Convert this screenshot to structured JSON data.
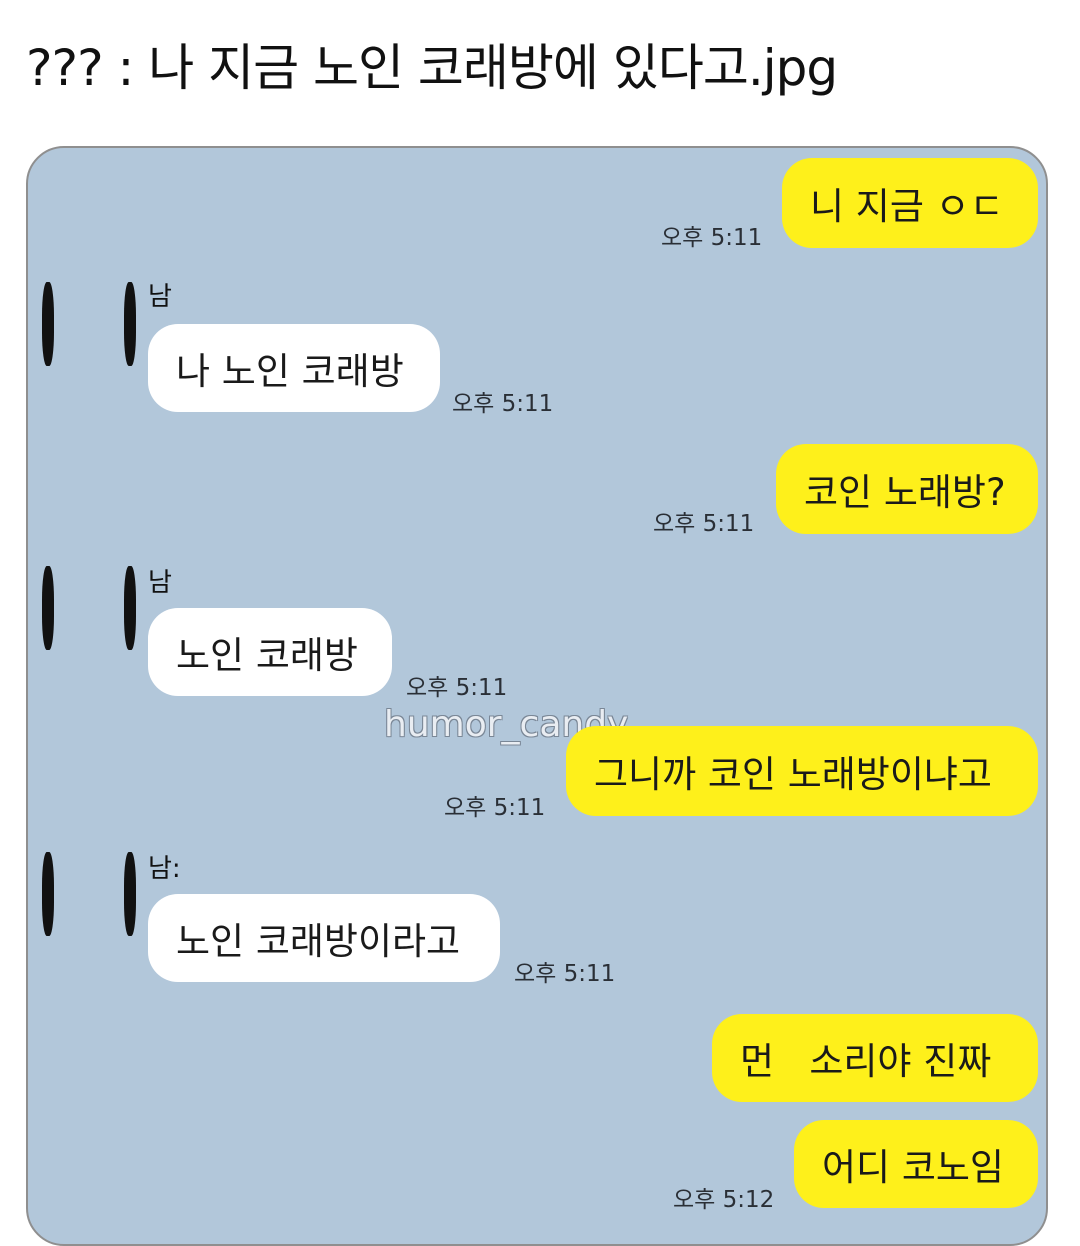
{
  "post": {
    "title": "??? : 나 지금 노인 코래방에 있다고.jpg"
  },
  "watermark": "humor_candy_",
  "messages": [
    {
      "side": "me",
      "text": "니 지금 ㅇㄷ",
      "time": "오후 5:11"
    },
    {
      "side": "them",
      "sender": "남",
      "text": "나 노인 코래방",
      "time": "오후 5:11"
    },
    {
      "side": "me",
      "text": "코인 노래방?",
      "time": "오후 5:11"
    },
    {
      "side": "them",
      "sender": "남",
      "text": "노인 코래방",
      "time": "오후 5:11"
    },
    {
      "side": "me",
      "text": "그니까 코인 노래방이냐고",
      "time": "오후 5:11"
    },
    {
      "side": "them",
      "sender": "남:",
      "text": "노인 코래방이라고",
      "time": "오후 5:11"
    },
    {
      "side": "me",
      "text": "먼   소리야 진짜",
      "time": ""
    },
    {
      "side": "me",
      "text": "어디 코노임",
      "time": "오후 5:12"
    }
  ],
  "colors": {
    "chat_bg": "#b2c7da",
    "my_bubble": "#fef01b",
    "their_bubble": "#ffffff"
  }
}
